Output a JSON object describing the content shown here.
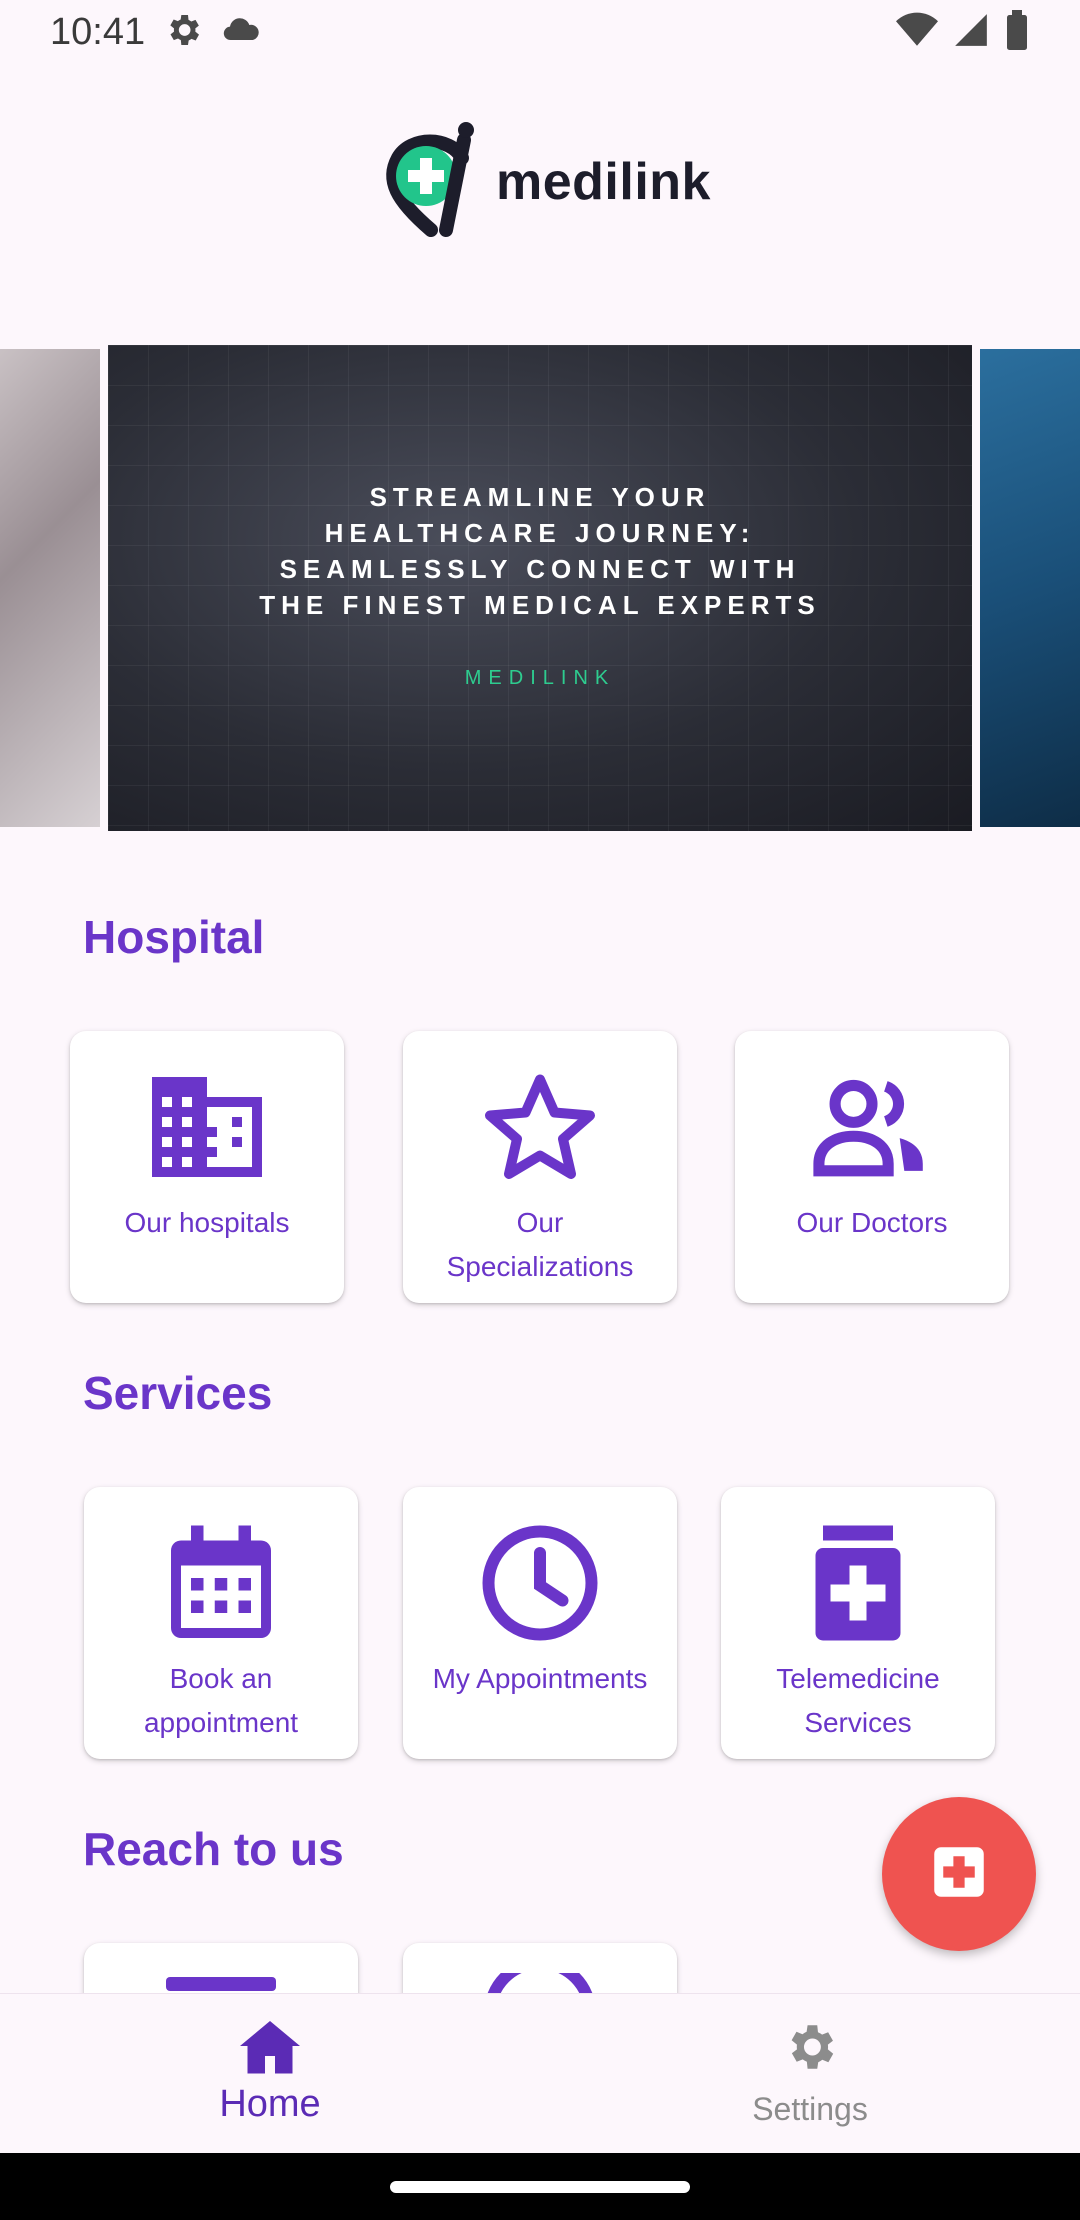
{
  "status_bar": {
    "time": "10:41",
    "icons": [
      "settings-gear-icon",
      "cloud-icon",
      "wifi-icon",
      "cellular-signal-icon",
      "battery-icon"
    ]
  },
  "logo": {
    "text": "medilink",
    "icon": "medilink-pin-cross-icon"
  },
  "carousel": {
    "headline": "STREAMLINE YOUR HEALTHCARE JOURNEY: SEAMLESSLY CONNECT WITH THE FINEST MEDICAL EXPERTS",
    "brand": "MEDILINK"
  },
  "sections": {
    "hospital": {
      "title": "Hospital",
      "cards": [
        {
          "label": "Our hospitals",
          "icon": "building-icon"
        },
        {
          "label": "Our Specializations",
          "icon": "star-icon"
        },
        {
          "label": "Our Doctors",
          "icon": "people-icon"
        }
      ]
    },
    "services": {
      "title": "Services",
      "cards": [
        {
          "label": "Book an appointment",
          "icon": "calendar-icon"
        },
        {
          "label": "My Appointments",
          "icon": "clock-icon"
        },
        {
          "label": "Telemedicine Services",
          "icon": "medical-kit-icon"
        }
      ]
    },
    "reach": {
      "title": "Reach to us"
    }
  },
  "fab": {
    "icon": "medical-plus-icon"
  },
  "bottom_nav": {
    "items": [
      {
        "label": "Home",
        "icon": "home-icon",
        "active": true
      },
      {
        "label": "Settings",
        "icon": "settings-gear-icon",
        "active": false
      }
    ]
  },
  "colors": {
    "accent": "#6a35c9",
    "fab": "#ef5350",
    "background": "#fdf7fc",
    "brand_green": "#2ecc8f"
  }
}
